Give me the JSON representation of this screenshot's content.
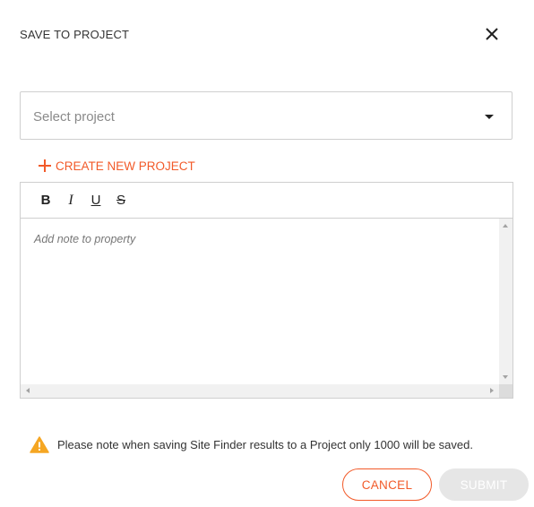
{
  "dialog": {
    "title": "SAVE TO PROJECT"
  },
  "project_select": {
    "placeholder": "Select project"
  },
  "create_project": {
    "label": "CREATE NEW PROJECT"
  },
  "editor": {
    "toolbar": {
      "bold": "B",
      "italic": "I",
      "underline": "U",
      "strikethrough": "S"
    },
    "placeholder": "Add note to property"
  },
  "notice": {
    "text": "Please note when saving Site Finder results to a Project only 1000 will be saved."
  },
  "buttons": {
    "cancel": "CANCEL",
    "submit": "SUBMIT"
  },
  "colors": {
    "accent": "#f25a29",
    "warning": "#f5a623",
    "disabled": "#e6e6e6"
  },
  "icons": {
    "close": "close-icon",
    "dropdown": "chevron-down-icon",
    "create": "plus-icon",
    "warning": "warning-icon"
  }
}
